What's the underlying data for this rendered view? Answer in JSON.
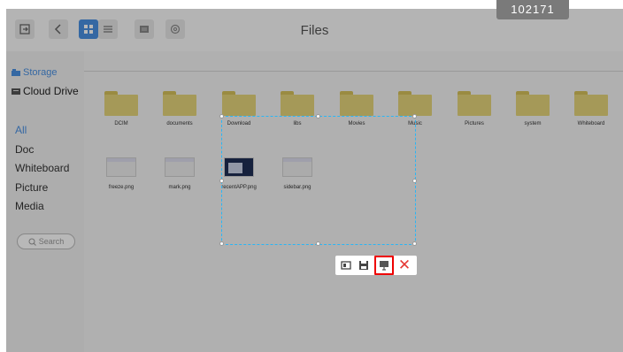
{
  "window": {
    "title": "Files",
    "badge": "102171"
  },
  "toolbar": {
    "buttons": [
      "exit-icon",
      "back-icon",
      "grid-view-icon",
      "list-view-icon",
      "select-icon",
      "settings-icon"
    ]
  },
  "sidebar": {
    "storage": "Storage",
    "cloud_drive": "Cloud Drive",
    "items": [
      "All",
      "Doc",
      "Whiteboard",
      "Picture",
      "Media"
    ],
    "search_placeholder": "Search"
  },
  "folders": [
    "DCIM",
    "documents",
    "Download",
    "libs",
    "Movies",
    "Music",
    "Pictures",
    "system",
    "Whiteboard"
  ],
  "files": [
    "freeze.png",
    "mark.png",
    "recentAPP.png",
    "sidebar.png"
  ],
  "selection_toolbar": {
    "buttons": [
      "crop-icon",
      "save-icon",
      "pin-icon",
      "close-icon"
    ],
    "close_glyph": "✕"
  },
  "colors": {
    "accent": "#4a90e2",
    "folder": "#e5d57b",
    "selection": "#29b6f6",
    "highlight": "#e00000",
    "close": "#e53935"
  }
}
